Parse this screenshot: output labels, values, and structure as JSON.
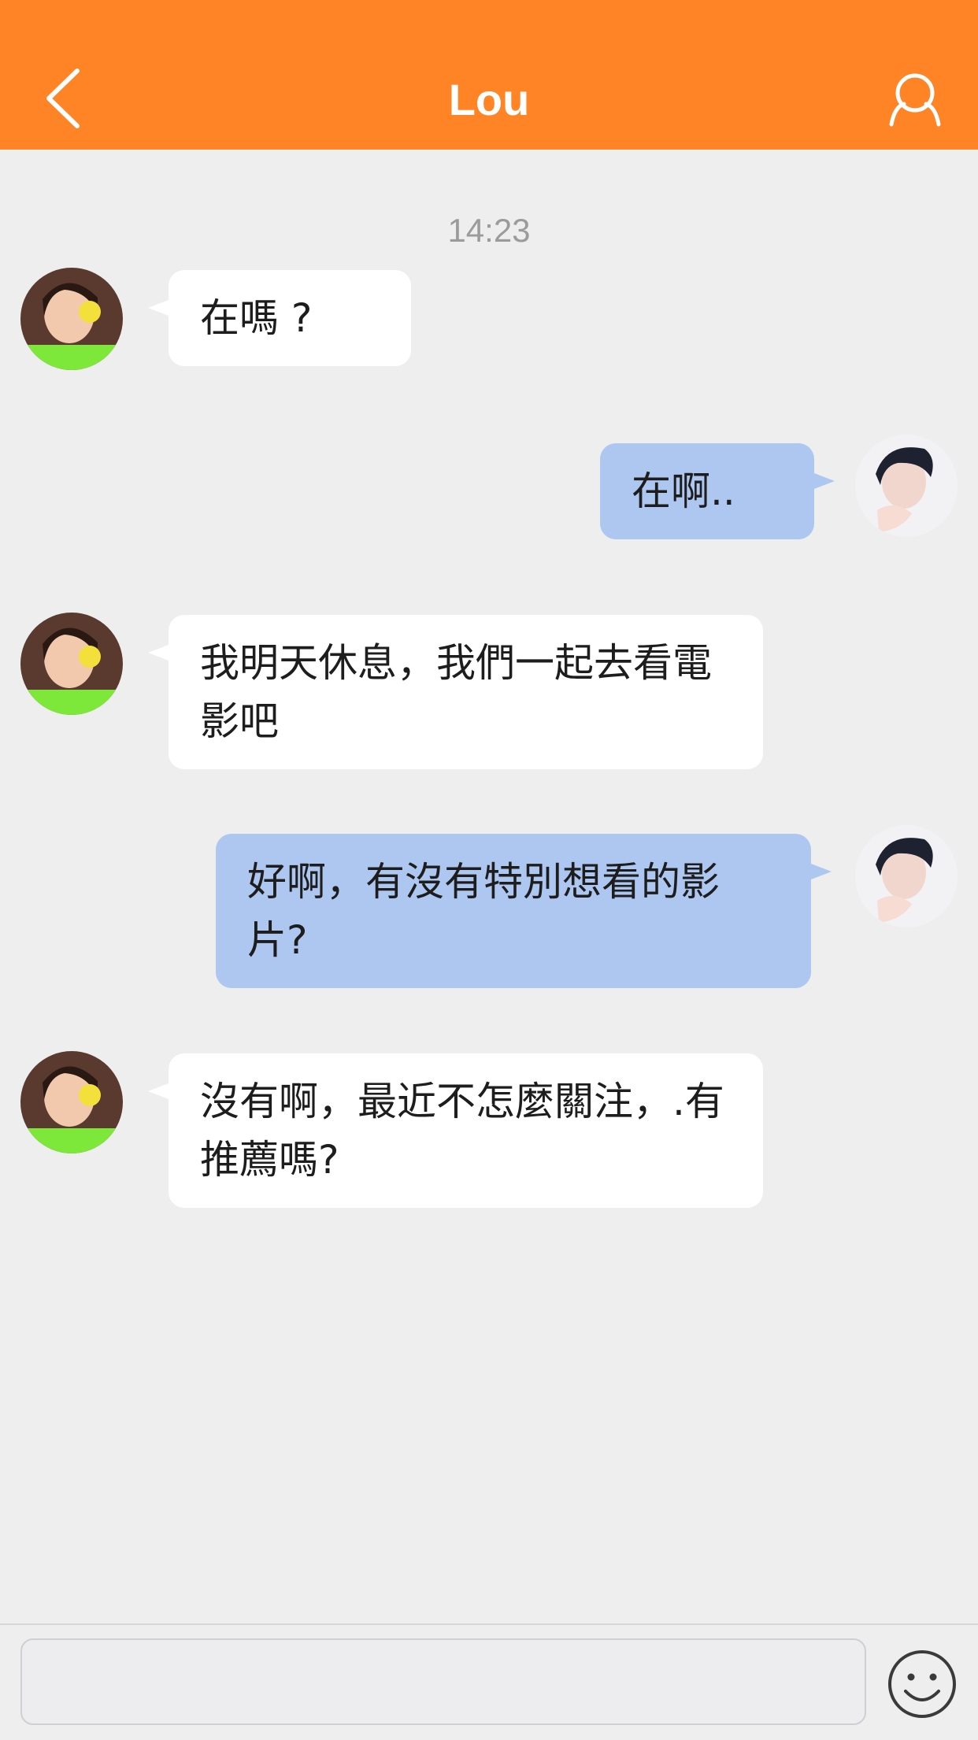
{
  "header": {
    "title": "Lou",
    "back_icon": "chevron-left-icon",
    "profile_icon": "user-profile-icon",
    "background_color": "#ff8426"
  },
  "chat": {
    "timestamp": "14:23",
    "messages": [
      {
        "sender": "contact",
        "text": "在嗎 ?"
      },
      {
        "sender": "me",
        "text": "在啊.."
      },
      {
        "sender": "contact",
        "text": "我明天休息，我們一起去看電影吧"
      },
      {
        "sender": "me",
        "text": "好啊，有沒有特別想看的影片?"
      },
      {
        "sender": "contact",
        "text": "沒有啊，最近不怎麼關注，.有推薦嗎?"
      }
    ],
    "incoming_bubble_color": "#ffffff",
    "outgoing_bubble_color": "#adc7f1"
  },
  "input": {
    "value": "",
    "placeholder": "",
    "emoji_icon": "smiley-icon"
  }
}
